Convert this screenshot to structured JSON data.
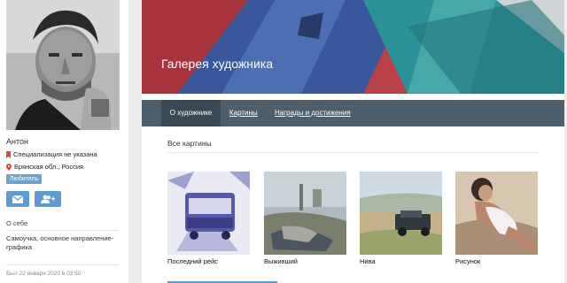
{
  "profile": {
    "name": "Антон",
    "specialization": "Специализация не указана",
    "location": "Брянская обл., Россия",
    "badge": "Любитель",
    "about_heading": "О себе",
    "about_text": "Самоучка, основное направление- графика",
    "last_visit": "Был 22 января 2020 в 03:50"
  },
  "gallery": {
    "title": "Галерея художника",
    "tabs": [
      {
        "label": "О художнике"
      },
      {
        "label": "Картины"
      },
      {
        "label": "Награды и достижения"
      }
    ],
    "section_title": "Все картины",
    "artworks": [
      {
        "title": "Последний рейс"
      },
      {
        "title": "Выживший"
      },
      {
        "title": "Нива"
      },
      {
        "title": "Рисунок"
      }
    ]
  },
  "colors": {
    "accent": "#5d9bd0",
    "nav_bg": "#4d5e6c",
    "nav_active": "#3a4955",
    "badge": "#6aa3cd",
    "marker": "#e0463e"
  }
}
